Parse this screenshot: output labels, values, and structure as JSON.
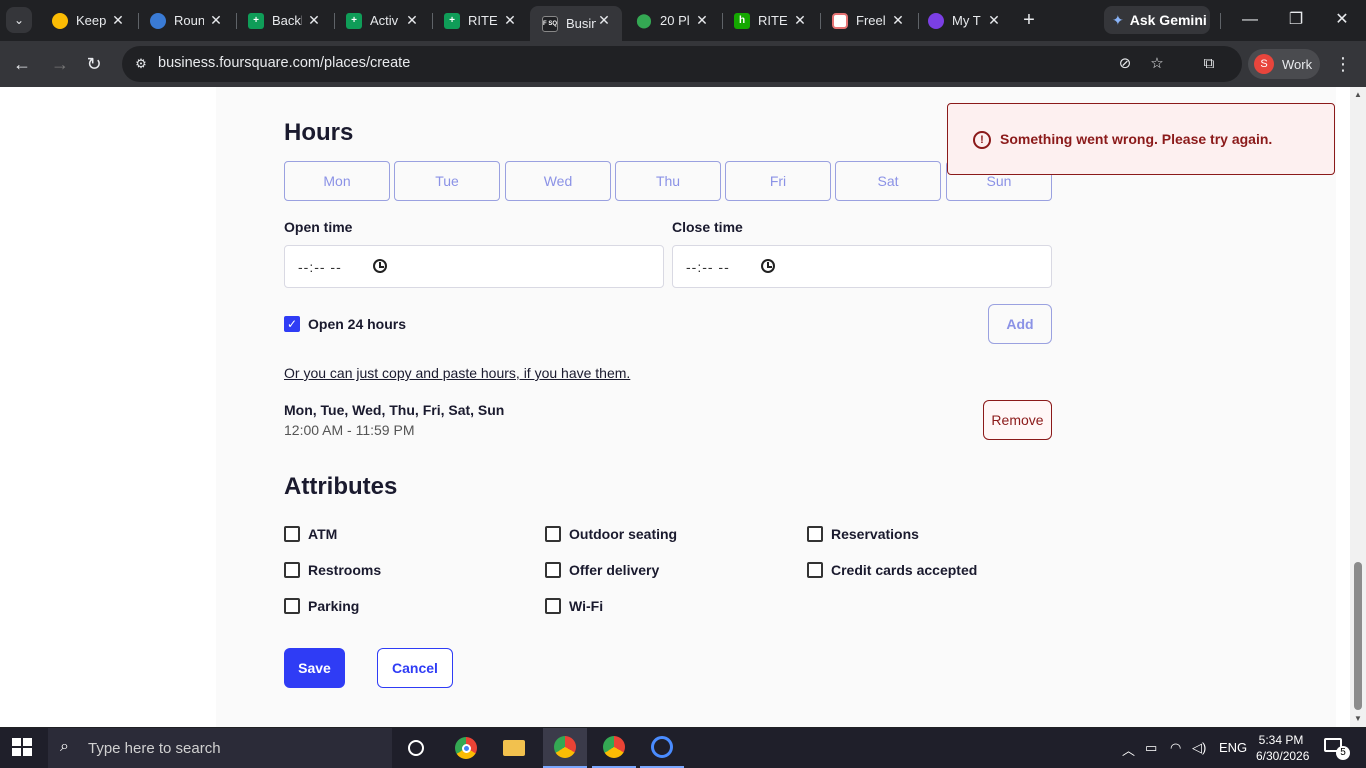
{
  "browser": {
    "tabs": [
      {
        "label": "Keep",
        "fav_color": "#fbbc04"
      },
      {
        "label": "Roun",
        "fav_color": "#3a7bd5"
      },
      {
        "label": "Backl",
        "fav_color": "#0f9d58"
      },
      {
        "label": "Activ",
        "fav_color": "#0f9d58"
      },
      {
        "label": "RITE",
        "fav_color": "#0f9d58"
      },
      {
        "label": "Busin",
        "fav_color": "#202124",
        "fav_text": "F SQ",
        "active": true
      },
      {
        "label": "20 Pl",
        "fav_color": "#34a853"
      },
      {
        "label": "RITE",
        "fav_color": "#14a800",
        "fav_text": "h"
      },
      {
        "label": "Freel",
        "fav_color": "#ffffff"
      },
      {
        "label": "My T",
        "fav_color": "#7b3fe4"
      }
    ],
    "ask_gemini": "Ask Gemini",
    "url": "business.foursquare.com/places/create",
    "profile_initial": "S",
    "profile_label": "Work"
  },
  "toast": {
    "message": "Something went wrong. Please try again.",
    "icon_text": "!"
  },
  "hours": {
    "heading": "Hours",
    "days": [
      "Mon",
      "Tue",
      "Wed",
      "Thu",
      "Fri",
      "Sat",
      "Sun"
    ],
    "open_time_label": "Open time",
    "close_time_label": "Close time",
    "open_time_value": "--:-- --",
    "close_time_value": "--:-- --",
    "open_24_label": "Open 24 hours",
    "open_24_checked": true,
    "add_label": "Add",
    "paste_link": "Or you can just copy and paste hours, if you have them.",
    "entry_days": "Mon, Tue, Wed, Thu, Fri, Sat, Sun",
    "entry_range": "12:00 AM - 11:59 PM",
    "remove_label": "Remove"
  },
  "attributes": {
    "heading": "Attributes",
    "col1": [
      "ATM",
      "Restrooms",
      "Parking"
    ],
    "col2": [
      "Outdoor seating",
      "Offer delivery",
      "Wi-Fi"
    ],
    "col3": [
      "Reservations",
      "Credit cards accepted"
    ]
  },
  "actions": {
    "save": "Save",
    "cancel": "Cancel"
  },
  "taskbar": {
    "search_placeholder": "Type here to search",
    "lang": "ENG",
    "time": "5:34 PM",
    "date": "6/30/2026",
    "notifications": "5"
  },
  "colors": {
    "accent": "#2f3cf5",
    "error": "#8b1a1a"
  }
}
